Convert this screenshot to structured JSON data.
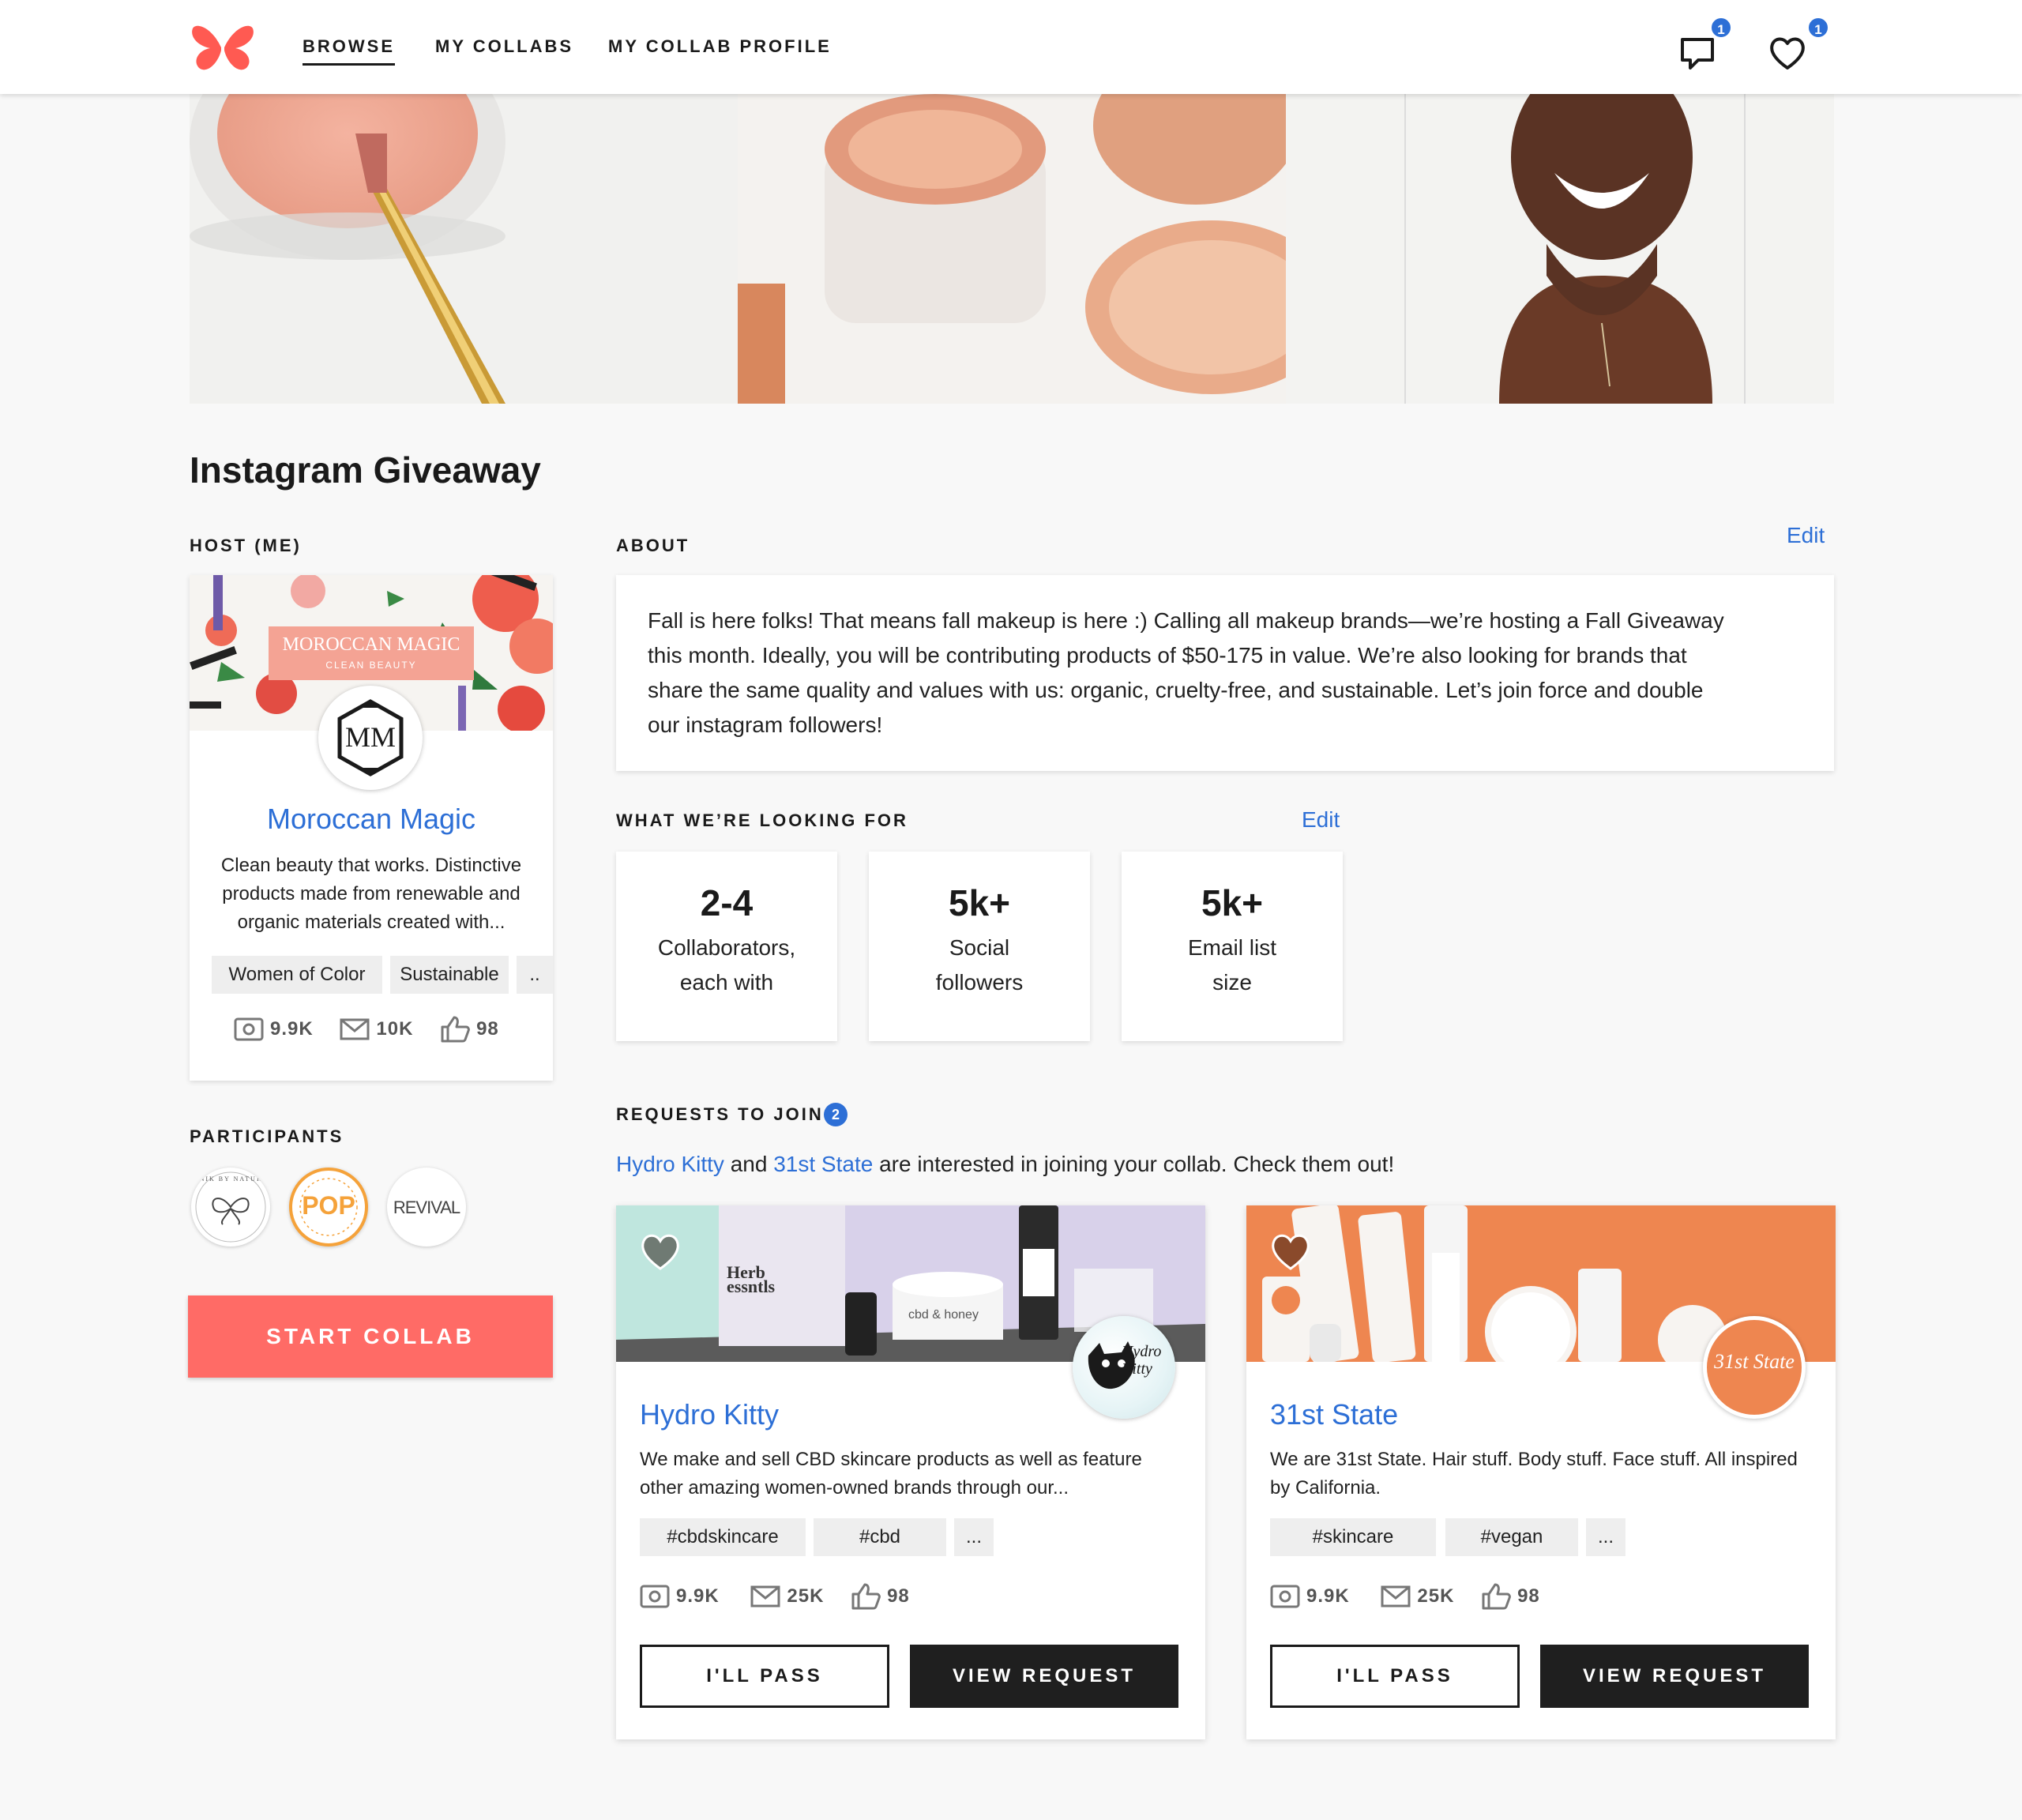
{
  "nav": {
    "links": [
      "BROWSE",
      "MY COLLABS",
      "MY COLLAB PROFILE"
    ],
    "messages_badge": "1",
    "favorites_badge": "1"
  },
  "page": {
    "title": "Instagram Giveaway"
  },
  "host": {
    "section_label": "HOST (ME)",
    "banner_brand": "MOROCCAN MAGIC",
    "banner_sub": "CLEAN BEAUTY",
    "logo_text": "MM",
    "name": "Moroccan Magic",
    "description": "Clean beauty that works. Distinctive products made from renewable and organic materials created with...",
    "tags": [
      "Women of Color",
      "Sustainable",
      ".."
    ],
    "stats": {
      "instagram": "9.9K",
      "email": "10K",
      "likes": "98"
    }
  },
  "participants": {
    "label": "PARTICIPANTS",
    "items": [
      {
        "name": "Unik by Nature",
        "text": "UNIK BY NATURE"
      },
      {
        "name": "Pop",
        "text": "POP"
      },
      {
        "name": "Revival",
        "text": "REVIVAL"
      }
    ]
  },
  "start_button": "START COLLAB",
  "about": {
    "label": "ABOUT",
    "edit": "Edit",
    "text": "Fall is here folks! That means fall makeup is here :) Calling all makeup brands—we’re hosting a Fall Giveaway this month. Ideally, you will be contributing products of $50-175 in value. We’re also looking for brands that share the same quality and values with us: organic, cruelty-free, and sustainable. Let’s join force and double our instagram followers!"
  },
  "looking_for": {
    "label": "WHAT WE’RE LOOKING FOR",
    "edit": "Edit",
    "items": [
      {
        "value": "2-4",
        "label": "Collaborators, each with"
      },
      {
        "value": "5k+",
        "label": "Social followers"
      },
      {
        "value": "5k+",
        "label": "Email list size"
      }
    ]
  },
  "requests": {
    "label": "REQUESTS TO JOIN",
    "count": "2",
    "sentence": {
      "brand1": "Hydro Kitty",
      "and": " and ",
      "brand2": "31st State",
      "rest": " are interested in joining your collab. Check them out!"
    },
    "cards": [
      {
        "name": "Hydro Kitty",
        "description": "We make and sell CBD skincare products as well as feature other amazing women-owned brands through our...",
        "tags": [
          "#cbdskincare",
          "#cbd",
          "..."
        ],
        "stats": {
          "instagram": "9.9K",
          "email": "25K",
          "likes": "98"
        },
        "banner_text": "Herb essntls",
        "jar_label": "cbd & honey",
        "logo_text": "Hydro Kitty",
        "heart_color": "#6f7a73",
        "pass_label": "I'LL PASS",
        "view_label": "VIEW REQUEST"
      },
      {
        "name": "31st State",
        "description": "We are 31st State. Hair stuff. Body stuff. Face stuff. All inspired by California.",
        "tags": [
          "#skincare",
          "#vegan",
          "..."
        ],
        "stats": {
          "instagram": "9.9K",
          "email": "25K",
          "likes": "98"
        },
        "logo_text": "31st State",
        "heart_color": "#8a4a2b",
        "pass_label": "I'LL PASS",
        "view_label": "VIEW REQUEST"
      }
    ]
  },
  "colors": {
    "accent_blue": "#2d6fd6",
    "start_button": "#ff6b66",
    "logo_red": "#ff5a52",
    "thirtyfirst_orange": "#ee8650"
  }
}
